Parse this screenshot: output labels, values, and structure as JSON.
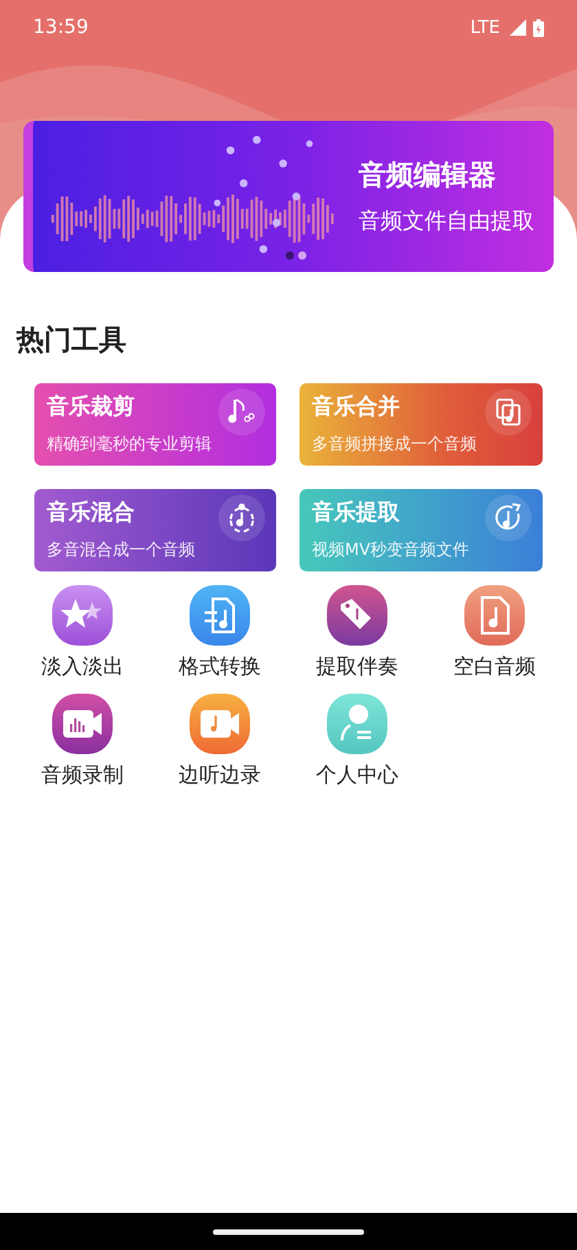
{
  "status_bar": {
    "time": "13:59",
    "network": "LTE"
  },
  "banner": {
    "title": "音频编辑器",
    "subtitle": "音频文件自由提取",
    "dots": [
      {
        "selected": true
      },
      {
        "selected": false
      }
    ]
  },
  "section_title": "热门工具",
  "feature_cards": [
    {
      "title": "音乐裁剪",
      "subtitle": "精确到毫秒的专业剪辑"
    },
    {
      "title": "音乐合并",
      "subtitle": "多音频拼接成一个音频"
    },
    {
      "title": "音乐混合",
      "subtitle": "多音混合成一个音频"
    },
    {
      "title": "音乐提取",
      "subtitle": "视频MV秒变音频文件"
    }
  ],
  "tools": [
    {
      "label": "淡入淡出"
    },
    {
      "label": "格式转换"
    },
    {
      "label": "提取伴奏"
    },
    {
      "label": "空白音频"
    },
    {
      "label": "音频录制"
    },
    {
      "label": "边听边录"
    },
    {
      "label": "个人中心"
    }
  ]
}
